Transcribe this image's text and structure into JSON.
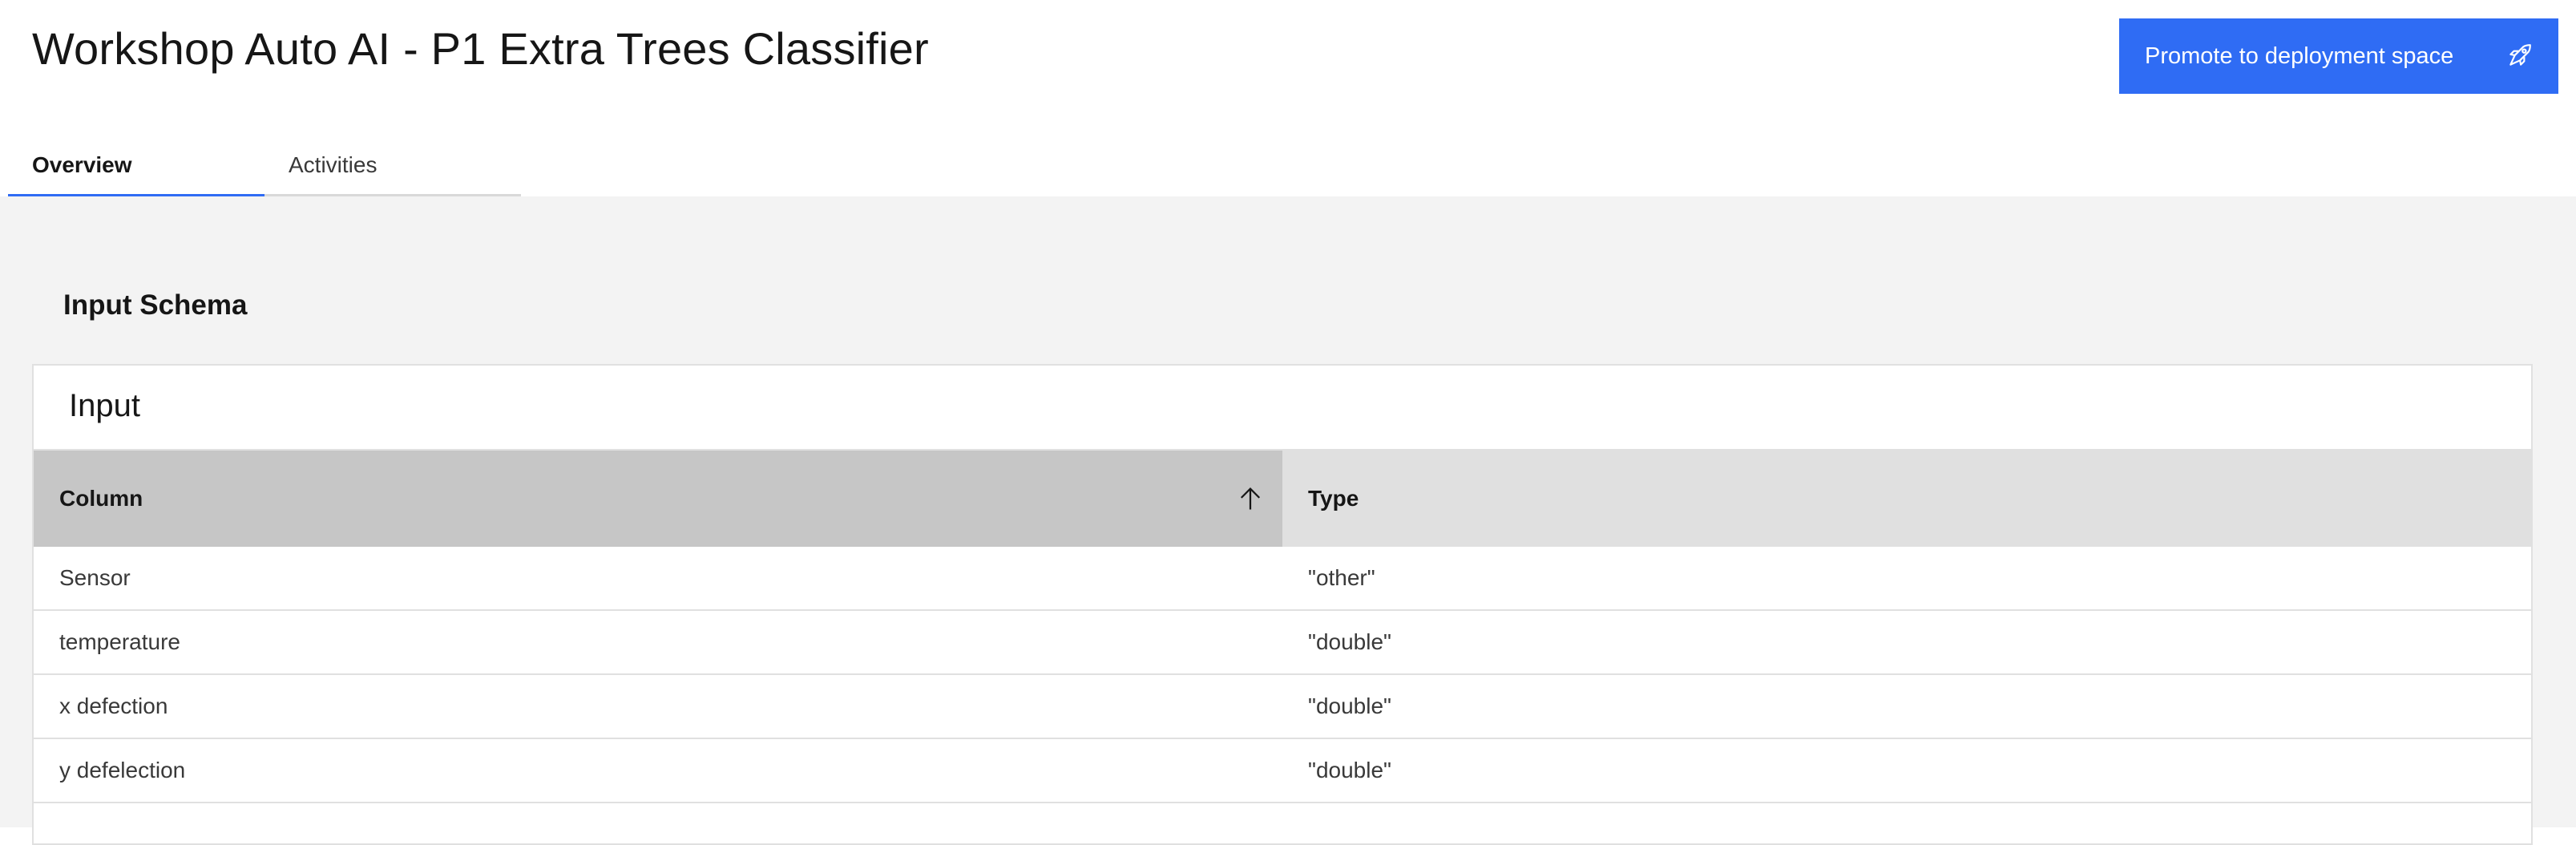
{
  "header": {
    "title": "Workshop Auto AI - P1 Extra Trees Classifier",
    "promote_button_label": "Promote to deployment space",
    "promote_button_icon": "rocket-icon"
  },
  "tabs": [
    {
      "label": "Overview",
      "active": true
    },
    {
      "label": "Activities",
      "active": false
    }
  ],
  "schema": {
    "section_title": "Input Schema",
    "table_title": "Input",
    "columns": {
      "column": "Column",
      "type": "Type"
    },
    "sort": {
      "column": "Column",
      "direction": "ascending",
      "icon": "arrow-up-icon"
    },
    "rows": [
      {
        "column": "Sensor",
        "type": "\"other\""
      },
      {
        "column": "temperature",
        "type": "\"double\""
      },
      {
        "column": "x defection",
        "type": "\"double\""
      },
      {
        "column": "y defelection",
        "type": "\"double\""
      },
      {
        "column": "",
        "type": ""
      }
    ]
  },
  "colors": {
    "accent": "#2f6cf4",
    "page_background": "#f3f3f3",
    "header_cell": "#e0e0e0",
    "sorted_header_cell": "#c6c6c6"
  }
}
